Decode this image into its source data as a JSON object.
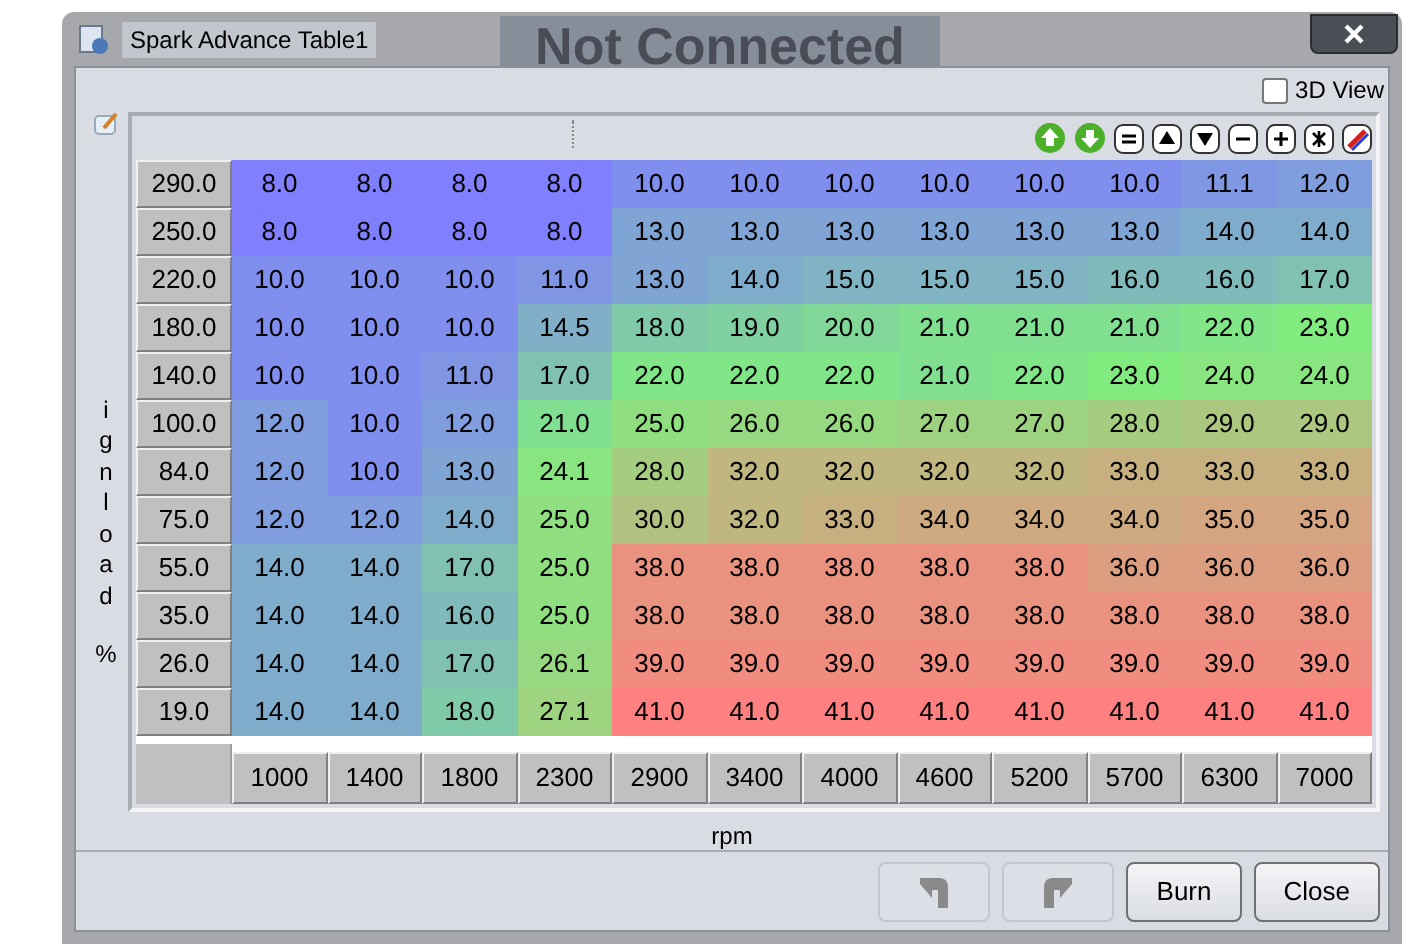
{
  "window": {
    "title": "Spark Advance Table1"
  },
  "background_text": "Not Connected",
  "view_3d": {
    "label": "3D View",
    "checked": false
  },
  "y_axis": {
    "label": "ignload",
    "unit": "%"
  },
  "rows": [
    {
      "load": "290.0",
      "values": [
        "8.0",
        "8.0",
        "8.0",
        "8.0",
        "10.0",
        "10.0",
        "10.0",
        "10.0",
        "10.0",
        "10.0",
        "11.1",
        "12.0"
      ]
    },
    {
      "load": "250.0",
      "values": [
        "8.0",
        "8.0",
        "8.0",
        "8.0",
        "13.0",
        "13.0",
        "13.0",
        "13.0",
        "13.0",
        "13.0",
        "14.0",
        "14.0"
      ]
    },
    {
      "load": "220.0",
      "values": [
        "10.0",
        "10.0",
        "10.0",
        "11.0",
        "13.0",
        "14.0",
        "15.0",
        "15.0",
        "15.0",
        "16.0",
        "16.0",
        "17.0"
      ]
    },
    {
      "load": "180.0",
      "values": [
        "10.0",
        "10.0",
        "10.0",
        "14.5",
        "18.0",
        "19.0",
        "20.0",
        "21.0",
        "21.0",
        "21.0",
        "22.0",
        "23.0"
      ]
    },
    {
      "load": "140.0",
      "values": [
        "10.0",
        "10.0",
        "11.0",
        "17.0",
        "22.0",
        "22.0",
        "22.0",
        "21.0",
        "22.0",
        "23.0",
        "24.0",
        "24.0"
      ]
    },
    {
      "load": "100.0",
      "values": [
        "12.0",
        "10.0",
        "12.0",
        "21.0",
        "25.0",
        "26.0",
        "26.0",
        "27.0",
        "27.0",
        "28.0",
        "29.0",
        "29.0"
      ]
    },
    {
      "load": "84.0",
      "values": [
        "12.0",
        "10.0",
        "13.0",
        "24.1",
        "28.0",
        "32.0",
        "32.0",
        "32.0",
        "32.0",
        "33.0",
        "33.0",
        "33.0"
      ]
    },
    {
      "load": "75.0",
      "values": [
        "12.0",
        "12.0",
        "14.0",
        "25.0",
        "30.0",
        "32.0",
        "33.0",
        "34.0",
        "34.0",
        "34.0",
        "35.0",
        "35.0"
      ]
    },
    {
      "load": "55.0",
      "values": [
        "14.0",
        "14.0",
        "17.0",
        "25.0",
        "38.0",
        "38.0",
        "38.0",
        "38.0",
        "38.0",
        "36.0",
        "36.0",
        "36.0"
      ]
    },
    {
      "load": "35.0",
      "values": [
        "14.0",
        "14.0",
        "16.0",
        "25.0",
        "38.0",
        "38.0",
        "38.0",
        "38.0",
        "38.0",
        "38.0",
        "38.0",
        "38.0"
      ]
    },
    {
      "load": "26.0",
      "values": [
        "14.0",
        "14.0",
        "17.0",
        "26.1",
        "39.0",
        "39.0",
        "39.0",
        "39.0",
        "39.0",
        "39.0",
        "39.0",
        "39.0"
      ]
    },
    {
      "load": "19.0",
      "values": [
        "14.0",
        "14.0",
        "18.0",
        "27.1",
        "41.0",
        "41.0",
        "41.0",
        "41.0",
        "41.0",
        "41.0",
        "41.0",
        "41.0"
      ]
    }
  ],
  "x_axis": {
    "values": [
      "1000",
      "1400",
      "1800",
      "2300",
      "2900",
      "3400",
      "4000",
      "4600",
      "5200",
      "5700",
      "6300",
      "7000"
    ],
    "label": "rpm"
  },
  "undo": {
    "disabled": true
  },
  "redo": {
    "disabled": true
  },
  "buttons": [
    {
      "label": "Burn"
    },
    {
      "label": "Close"
    }
  ]
}
